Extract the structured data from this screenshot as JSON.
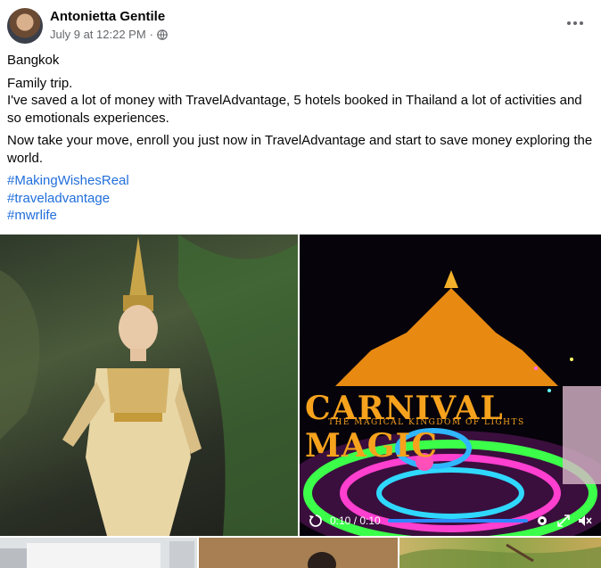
{
  "post": {
    "author": "Antonietta Gentile",
    "timestamp": "July 9 at 12:22 PM",
    "separator": "·",
    "privacy_icon": "globe-icon",
    "more_icon": "more-options-icon"
  },
  "body": {
    "location": "Bangkok",
    "para1": "Family trip.\nI've saved a lot of money with TravelAdvantage, 5 hotels booked in Thailand a lot of activities and so emotionals experiences.",
    "para2": "Now take your move, enroll you just now in TravelAdvantage and start  to save money exploring the world.",
    "hashtags": [
      "#MakingWishesReal",
      "#traveladvantage",
      "#mwrlife"
    ]
  },
  "media": {
    "video_sign_title": "CARNIVAL MAGIC",
    "video_sign_subtitle": "THE MAGICAL KINGDOM OF LIGHTS",
    "video_time": "0:10 / 0:10",
    "video_progress": 1.0,
    "icons": [
      "replay-icon",
      "settings-icon",
      "fullscreen-icon",
      "mute-icon"
    ]
  },
  "colors": {
    "hashtag": "#216fdb",
    "meta": "#65676b",
    "progress": "#2d88ff",
    "sign": "#f6a21d"
  }
}
